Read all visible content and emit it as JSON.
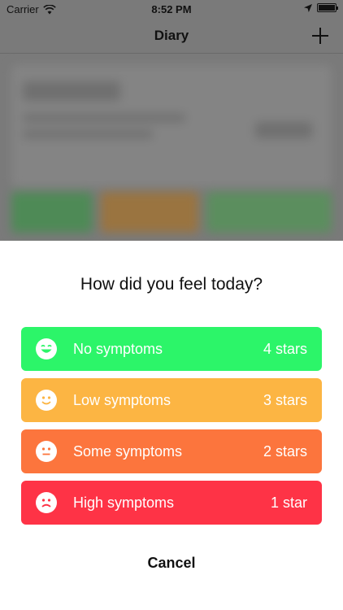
{
  "status_bar": {
    "carrier": "Carrier",
    "time": "8:52 PM"
  },
  "nav": {
    "title": "Diary"
  },
  "sheet": {
    "title": "How did you feel today?",
    "options": [
      {
        "label": "No symptoms",
        "stars": "4 stars",
        "color": "#2cf569",
        "icon": "laughing-face-icon"
      },
      {
        "label": "Low symptoms",
        "stars": "3 stars",
        "color": "#fcb543",
        "icon": "smiling-face-icon"
      },
      {
        "label": "Some symptoms",
        "stars": "2 stars",
        "color": "#fc753d",
        "icon": "neutral-face-icon"
      },
      {
        "label": "High symptoms",
        "stars": "1 star",
        "color": "#fe3346",
        "icon": "sad-face-icon"
      }
    ],
    "cancel_label": "Cancel"
  }
}
